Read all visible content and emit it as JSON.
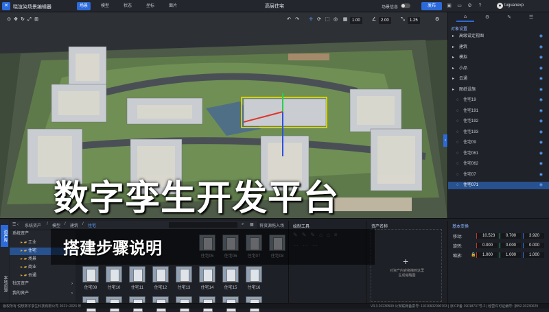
{
  "app": {
    "title": "晓渲染场景编辑器",
    "center_title": "高层住宅",
    "scene_label": "场景信息",
    "publish": "发布",
    "user": "tuguanexp"
  },
  "top_tabs": [
    {
      "label": "场景",
      "active": true
    },
    {
      "label": "模型",
      "active": false
    },
    {
      "label": "状态",
      "active": false
    },
    {
      "label": "坐标",
      "active": false
    },
    {
      "label": "面片",
      "active": false
    }
  ],
  "viewport_toolbar": {
    "v1": "1.00",
    "v2": "2.00",
    "v3": "1.25"
  },
  "overlay": {
    "title": "数字孪生开发平台",
    "subtitle": "搭建步骤说明"
  },
  "right_panel": {
    "header": "对象设置",
    "tree": [
      {
        "label": "高级设定视图",
        "selected": false
      },
      {
        "label": "建筑",
        "selected": false
      },
      {
        "label": "模拟",
        "selected": false
      },
      {
        "label": "小品",
        "selected": false
      },
      {
        "label": "云通",
        "selected": false
      },
      {
        "label": "图纸设施",
        "selected": false
      },
      {
        "label": "住宅19",
        "selected": false
      },
      {
        "label": "住宅191",
        "selected": false
      },
      {
        "label": "住宅192",
        "selected": false
      },
      {
        "label": "住宅193",
        "selected": false
      },
      {
        "label": "住宅09",
        "selected": false
      },
      {
        "label": "住宅061",
        "selected": false
      },
      {
        "label": "住宅062",
        "selected": false
      },
      {
        "label": "住宅07",
        "selected": false
      },
      {
        "label": "住宅071",
        "selected": true
      }
    ]
  },
  "assets": {
    "side_tabs": [
      "资产库",
      "本地资源"
    ],
    "breadcrumb": [
      "系统资产",
      "模型",
      "建筑",
      "住宅"
    ],
    "categories": [
      {
        "label": "系统资产",
        "selected": false
      },
      {
        "label": "工业",
        "selected": false
      },
      {
        "label": "住宅",
        "selected": true
      },
      {
        "label": "场景",
        "selected": false
      },
      {
        "label": "商业",
        "selected": false
      },
      {
        "label": "云通",
        "selected": false
      },
      {
        "label": "社区资产",
        "selected": false
      },
      {
        "label": "我的资产",
        "selected": false
      }
    ],
    "row1": [
      "住宅05",
      "住宅06",
      "住宅07",
      "住宅08"
    ],
    "row2": [
      "住宅09",
      "住宅10",
      "住宅11",
      "住宅12",
      "住宅13",
      "住宅14",
      "住宅15",
      "住宅16"
    ],
    "apply_label": "将资源拖入场",
    "draw_tools": "绘制工具",
    "asset_name": "资产名称",
    "drop_hint_1": "对资产内容拖拽到这里",
    "drop_hint_2": "生成缩略图"
  },
  "transform": {
    "title": "基本变换",
    "rows": [
      {
        "label": "移动:",
        "x": "10.523",
        "y": "0.700",
        "z": "3.920"
      },
      {
        "label": "旋转:",
        "x": "0.000",
        "y": "0.000",
        "z": "0.000"
      },
      {
        "label": "缩放:",
        "x": "1.000",
        "y": "1.000",
        "z": "1.000"
      }
    ],
    "colors": {
      "x": "#c0392b",
      "y": "#27ae60",
      "z": "#2c6ad9"
    }
  },
  "status": {
    "left": "版权所有 悦想数字孪生科技有限公司 2021~2023 年",
    "right": "V3.3.20230509 公安联网备案号: 11010602000763 | 京ICP备 19018737号-2 | 经营许可证编号: 京B2-20230029"
  }
}
